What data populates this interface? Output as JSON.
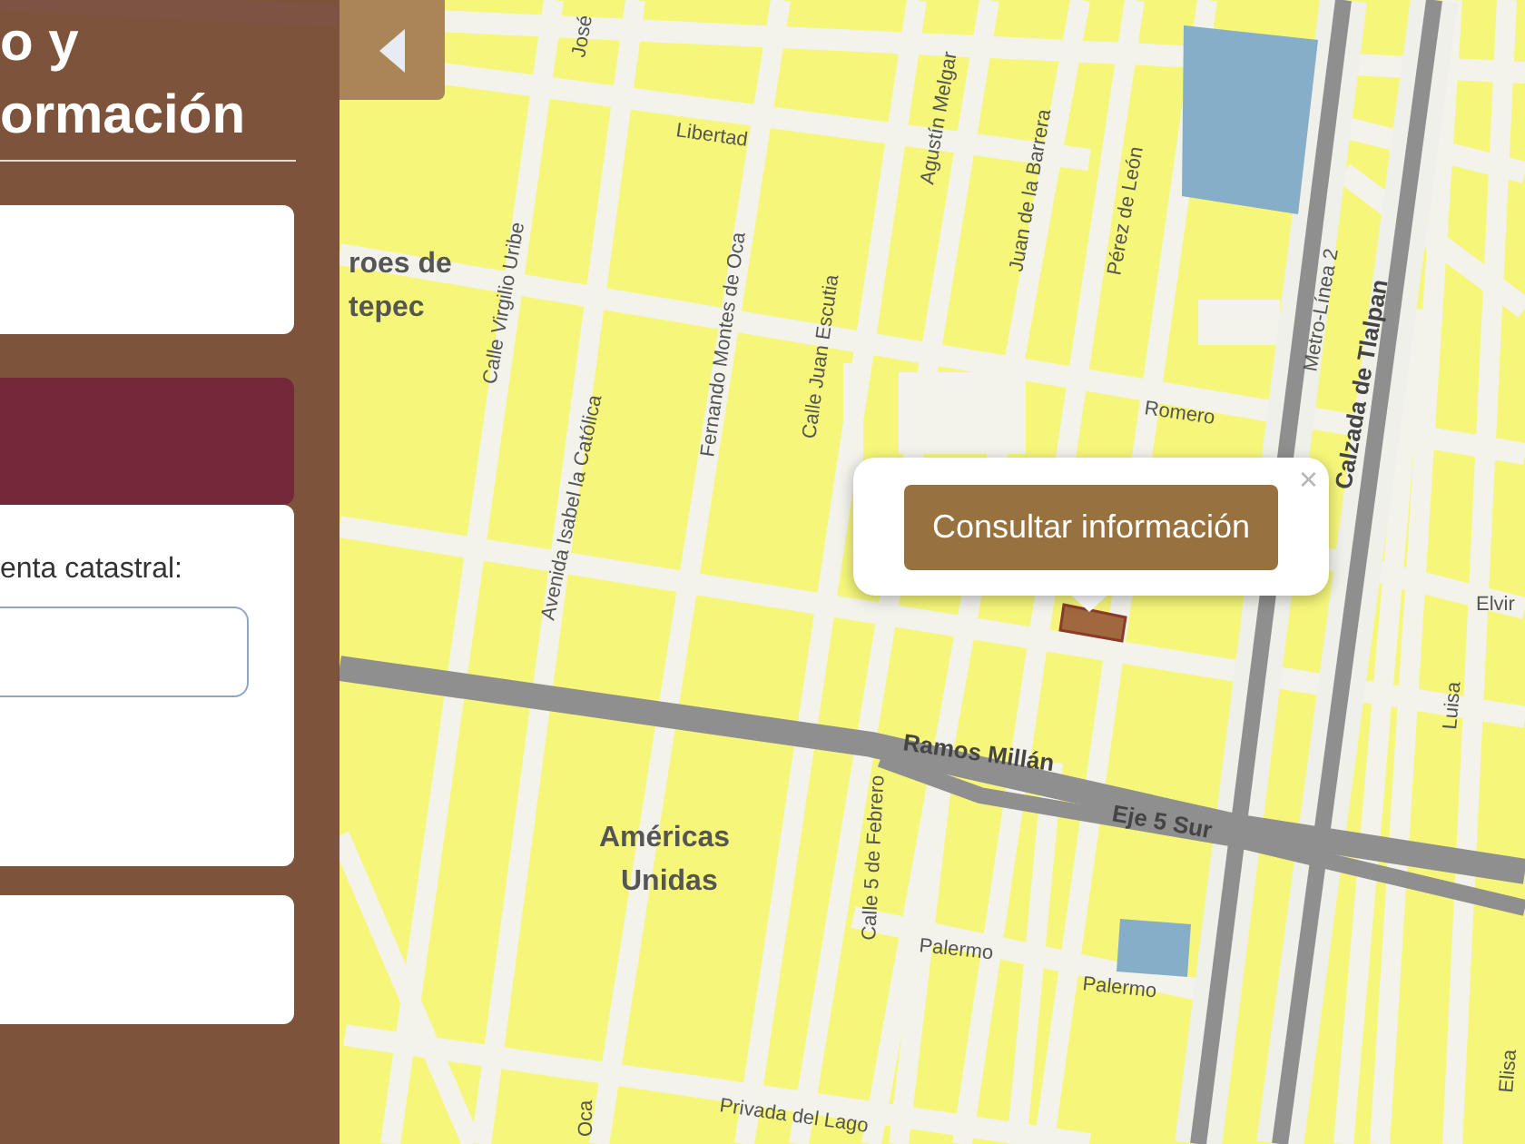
{
  "sidebar": {
    "title_lines": [
      "o y",
      "ormación"
    ],
    "field_label": "enta catastral:"
  },
  "popup": {
    "button": "Consultar información",
    "close": "×"
  },
  "map_labels": [
    {
      "text": "José",
      "kind": "street"
    },
    {
      "text": "Libertad",
      "kind": "street"
    },
    {
      "text": "Agustín Melgar",
      "kind": "street"
    },
    {
      "text": "Juan de la Barrera",
      "kind": "street"
    },
    {
      "text": "Pérez de León",
      "kind": "street"
    },
    {
      "text": "Metro-Línea 2",
      "kind": "street"
    },
    {
      "text": "Calzada de Tlalpan",
      "kind": "major"
    },
    {
      "text": "Calle Virgilio Uribe",
      "kind": "street"
    },
    {
      "text": "Avenida Isabel la Católica",
      "kind": "street"
    },
    {
      "text": "Fernando Montes de Oca",
      "kind": "street"
    },
    {
      "text": "Calle Juan Escutia",
      "kind": "street"
    },
    {
      "text": "Romero",
      "kind": "street"
    },
    {
      "text": "roes de",
      "kind": "neighborhood"
    },
    {
      "text": "tepec",
      "kind": "neighborhood"
    },
    {
      "text": "Ramos Millán",
      "kind": "major"
    },
    {
      "text": "Eje 5 Sur",
      "kind": "major"
    },
    {
      "text": "Calle 5 de Febrero",
      "kind": "street"
    },
    {
      "text": "Américas",
      "kind": "neighborhood"
    },
    {
      "text": "Unidas",
      "kind": "neighborhood"
    },
    {
      "text": "Palermo",
      "kind": "street"
    },
    {
      "text": "Palermo",
      "kind": "street"
    },
    {
      "text": "Privada del Lago",
      "kind": "street"
    },
    {
      "text": "Oca",
      "kind": "street"
    },
    {
      "text": "Luisa",
      "kind": "street"
    },
    {
      "text": "Elvir",
      "kind": "street"
    },
    {
      "text": "Elisa",
      "kind": "street"
    }
  ]
}
